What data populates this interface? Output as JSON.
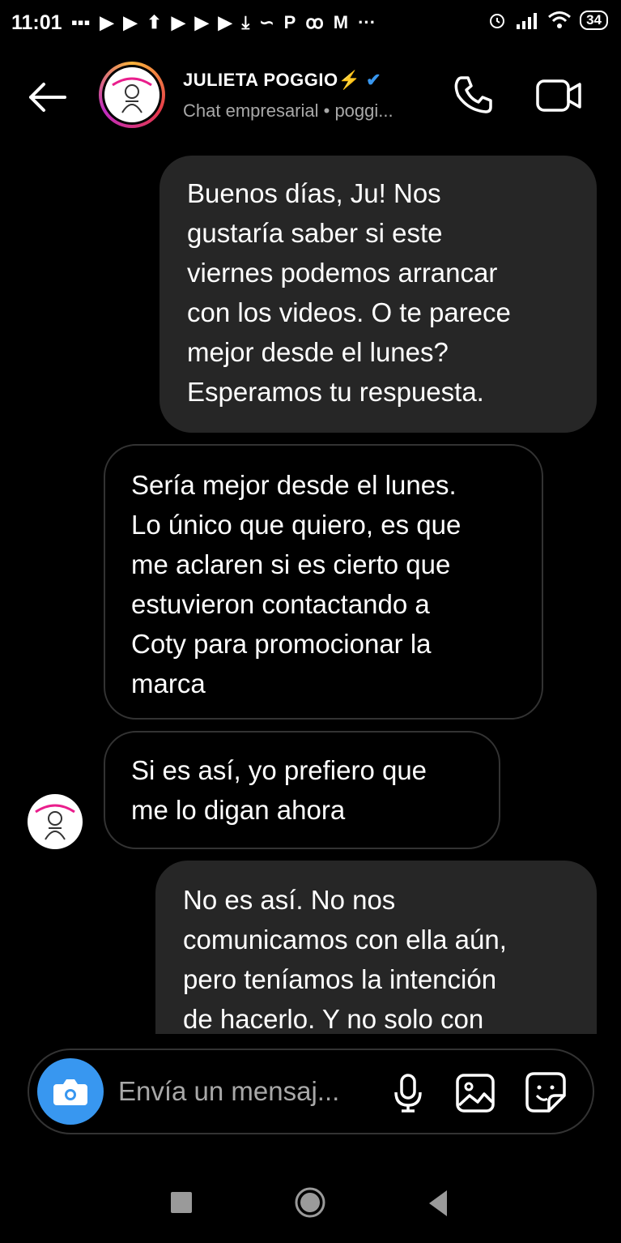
{
  "status_bar": {
    "time": "11:01",
    "battery": "34",
    "notification_icons": [
      "message-icon",
      "play-icon",
      "play-icon",
      "upload-icon",
      "play-icon",
      "play-icon",
      "play-icon",
      "download-icon",
      "link-icon",
      "p-icon",
      "app-icon",
      "gmail-icon",
      "more-dots-icon"
    ],
    "notification_glyphs": [
      "▪▪▪",
      "▶",
      "▶",
      "⬆",
      "▶",
      "▶",
      "▶",
      "⤓",
      "∽",
      "P",
      "ꝏ",
      "M",
      "···"
    ],
    "right_icons": [
      "alarm-icon",
      "signal-icon",
      "wifi-icon",
      "battery-icon"
    ]
  },
  "header": {
    "name": "JULIETA POGGIO",
    "bolt": "⚡",
    "verified": "✔",
    "subtitle": "Chat empresarial • poggi..."
  },
  "messages": [
    {
      "sender": "me",
      "lines": [
        "Buenos días, Ju! Nos",
        "gustaría saber si este",
        "viernes podemos arrancar",
        "con los videos. O te parece",
        "mejor desde el lunes?",
        "Esperamos tu respuesta."
      ]
    },
    {
      "sender": "them",
      "lines": [
        "Sería mejor desde el lunes.",
        "Lo único que quiero, es que",
        "me aclaren si es cierto que",
        "estuvieron contactando a",
        "Coty para promocionar la",
        "marca"
      ]
    },
    {
      "sender": "them",
      "lines": [
        "Si es así, yo prefiero que",
        "me lo digan ahora"
      ]
    },
    {
      "sender": "me",
      "lines": [
        "No es así. No nos",
        "comunicamos con ella aún,",
        "pero teníamos la intención",
        "de hacerlo. Y no solo con"
      ]
    }
  ],
  "composer": {
    "placeholder": "Envía un mensaj..."
  },
  "colors": {
    "background": "#000000",
    "bubble": "#262626",
    "accent": "#3897f0",
    "secondary_text": "#a8a8a8"
  }
}
